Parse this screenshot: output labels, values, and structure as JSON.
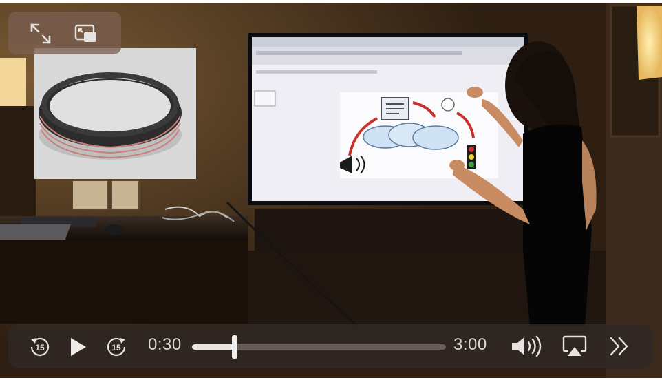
{
  "player": {
    "current_time": "0:30",
    "duration": "3:00",
    "progress": 0.1667,
    "skip_back_label": "15",
    "skip_forward_label": "15"
  },
  "colors": {
    "bar_bg": "#302824",
    "control": "#e6e2df",
    "scene_wall": "#3a2818"
  },
  "icons": {
    "fullscreen": "fullscreen-icon",
    "picture_in_picture": "pip-icon",
    "skip_back": "skip-back-15-icon",
    "play": "play-icon",
    "skip_forward": "skip-forward-15-icon",
    "volume": "volume-icon",
    "airplay": "airplay-icon",
    "more": "chevron-double-right-icon"
  }
}
